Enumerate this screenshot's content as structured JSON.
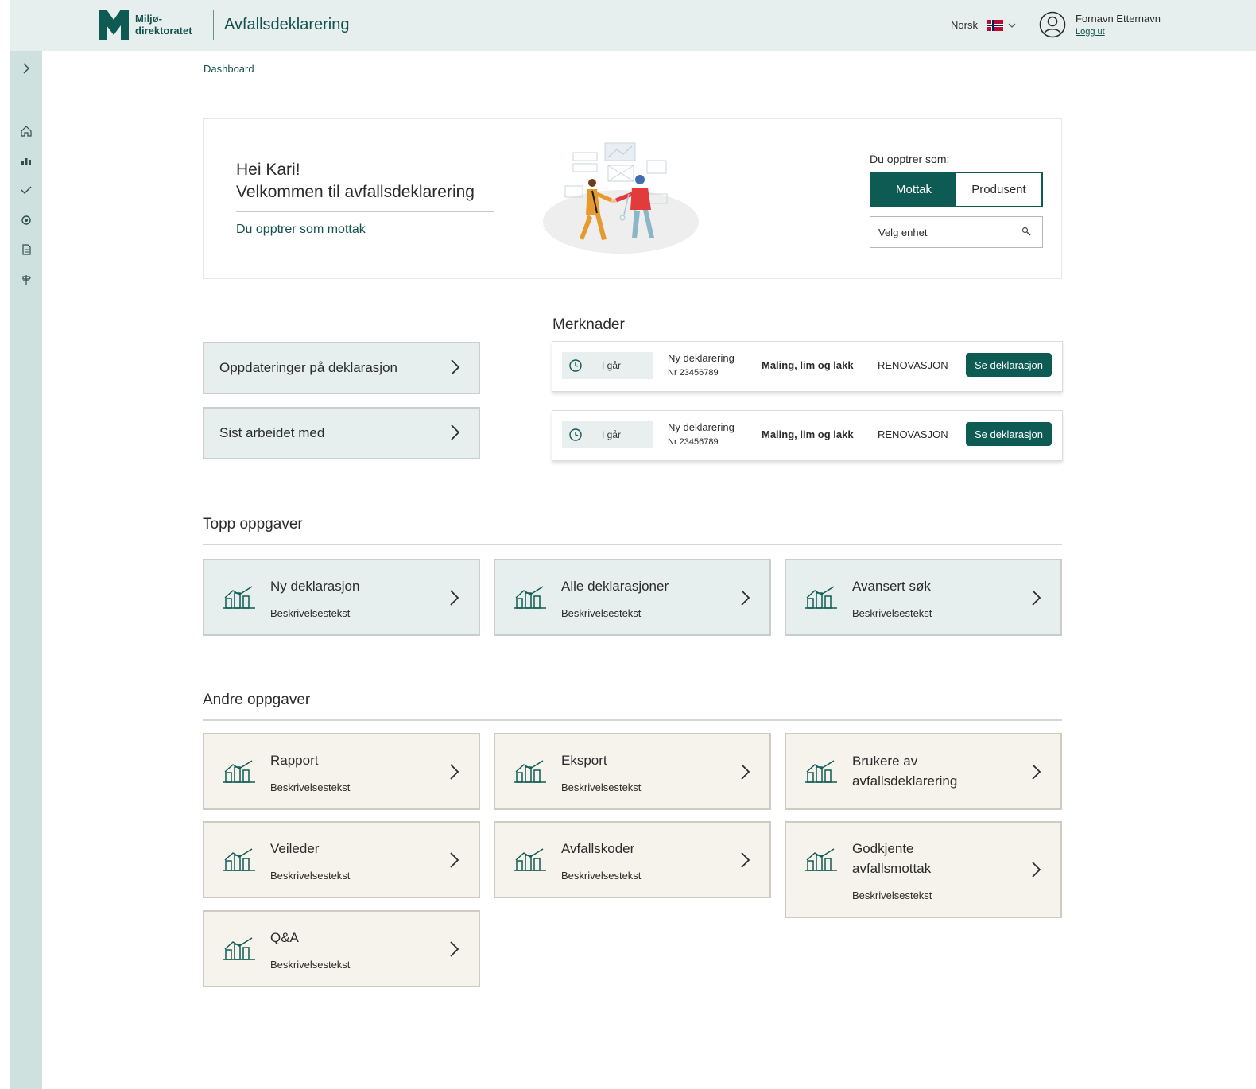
{
  "header": {
    "logo_line1": "Miljø-",
    "logo_line2": "direktoratet",
    "app_title": "Avfallsdeklarering",
    "language": "Norsk",
    "user_name": "Fornavn Etternavn",
    "logout": "Logg ut"
  },
  "colors": {
    "brand": "#0e5b54",
    "header_bg": "#e7efee",
    "sidebar_bg": "#cfe1df",
    "card_other_bg": "#f6f3ec"
  },
  "sidebar": {
    "icons": [
      "chevron-right-icon",
      "home-icon",
      "chart-icon",
      "check-icon",
      "gear-icon",
      "document-icon",
      "signpost-icon"
    ]
  },
  "breadcrumb": "Dashboard",
  "welcome": {
    "greeting": "Hei Kari!",
    "welcome_text": "Velkommen til avfallsdeklarering",
    "role_text": "Du opptrer som mottak",
    "role_label": "Du opptrer som:",
    "role_options": [
      "Mottak",
      "Produsent"
    ],
    "selected_role": "Mottak",
    "unit_placeholder": "Velg enhet"
  },
  "nav_cards": [
    {
      "label": "Oppdateringer på deklarasjon"
    },
    {
      "label": "Sist arbeidet med"
    }
  ],
  "merknader": {
    "title": "Merknader",
    "items": [
      {
        "time": "I går",
        "type": "Ny deklarering",
        "nr": "Nr 23456789",
        "category": "Maling, lim og lakk",
        "org": "RENOVASJON",
        "button": "Se deklarasjon"
      },
      {
        "time": "I går",
        "type": "Ny deklarering",
        "nr": "Nr 23456789",
        "category": "Maling, lim og lakk",
        "org": "RENOVASJON",
        "button": "Se deklarasjon"
      }
    ]
  },
  "top_tasks": {
    "title": "Topp oppgaver",
    "items": [
      {
        "title": "Ny deklarasjon",
        "desc": "Beskrivelsestekst"
      },
      {
        "title": "Alle deklarasjoner",
        "desc": "Beskrivelsestekst"
      },
      {
        "title": "Avansert søk",
        "desc": "Beskrivelsestekst"
      }
    ]
  },
  "other_tasks": {
    "title": "Andre oppgaver",
    "items": [
      {
        "title": "Rapport",
        "desc": "Beskrivelsestekst"
      },
      {
        "title": "Eksport",
        "desc": "Beskrivelsestekst"
      },
      {
        "title_line1": "Brukere av",
        "title_line2": "avfallsdeklarering"
      },
      {
        "title": "Veileder",
        "desc": "Beskrivelsestekst"
      },
      {
        "title": "Avfallskoder",
        "desc": "Beskrivelsestekst"
      },
      {
        "title_line1": "Godkjente",
        "title_line2": "avfallsmottak",
        "desc": "Beskrivelsestekst"
      },
      {
        "title": "Q&A",
        "desc": "Beskrivelsestekst"
      }
    ]
  }
}
